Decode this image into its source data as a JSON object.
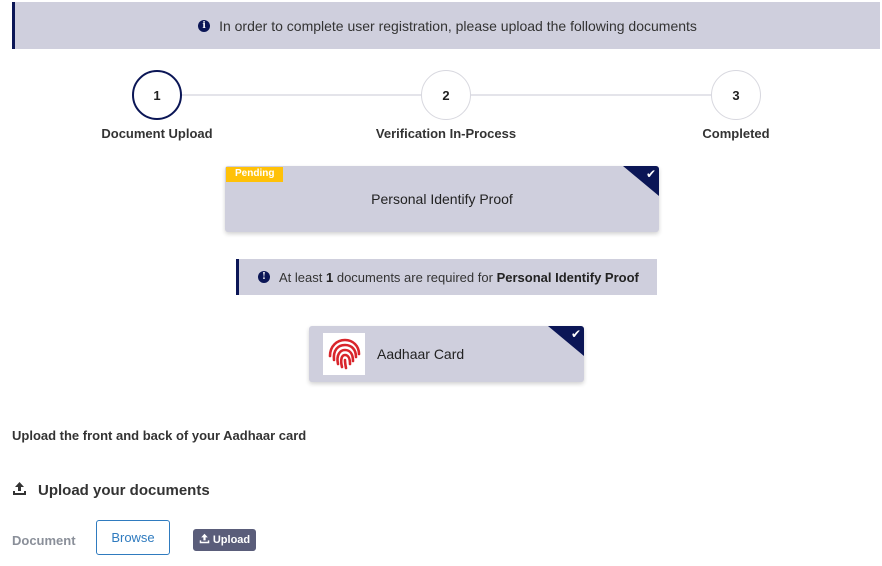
{
  "banner": {
    "icon": "info-icon",
    "text": "In order to complete user registration, please upload the following documents"
  },
  "stepper": {
    "steps": [
      {
        "number": "1",
        "label": "Document Upload",
        "active": true
      },
      {
        "number": "2",
        "label": "Verification In-Process",
        "active": false
      },
      {
        "number": "3",
        "label": "Completed",
        "active": false
      }
    ]
  },
  "proof_card": {
    "status": "Pending",
    "title": "Personal Identify Proof",
    "corner_icon": "check-icon"
  },
  "required_note": {
    "icon": "info-icon",
    "prefix": "At least ",
    "count": "1",
    "middle": " documents are required for ",
    "category": "Personal Identify Proof"
  },
  "document_card": {
    "logo": "aadhaar-fingerprint-logo",
    "name": "Aadhaar Card",
    "corner_icon": "check-icon"
  },
  "upload": {
    "hint": "Upload the front and back of your Aadhaar card",
    "heading": "Upload your documents",
    "heading_icon": "upload-icon",
    "field_label": "Document",
    "browse_label": "Browse",
    "upload_label": "Upload"
  },
  "colors": {
    "navy": "#0b1656",
    "panel": "#cfcfdd",
    "pending": "#ffc107",
    "link_blue": "#2f7bbf",
    "upload_button": "#5a5d7a"
  }
}
